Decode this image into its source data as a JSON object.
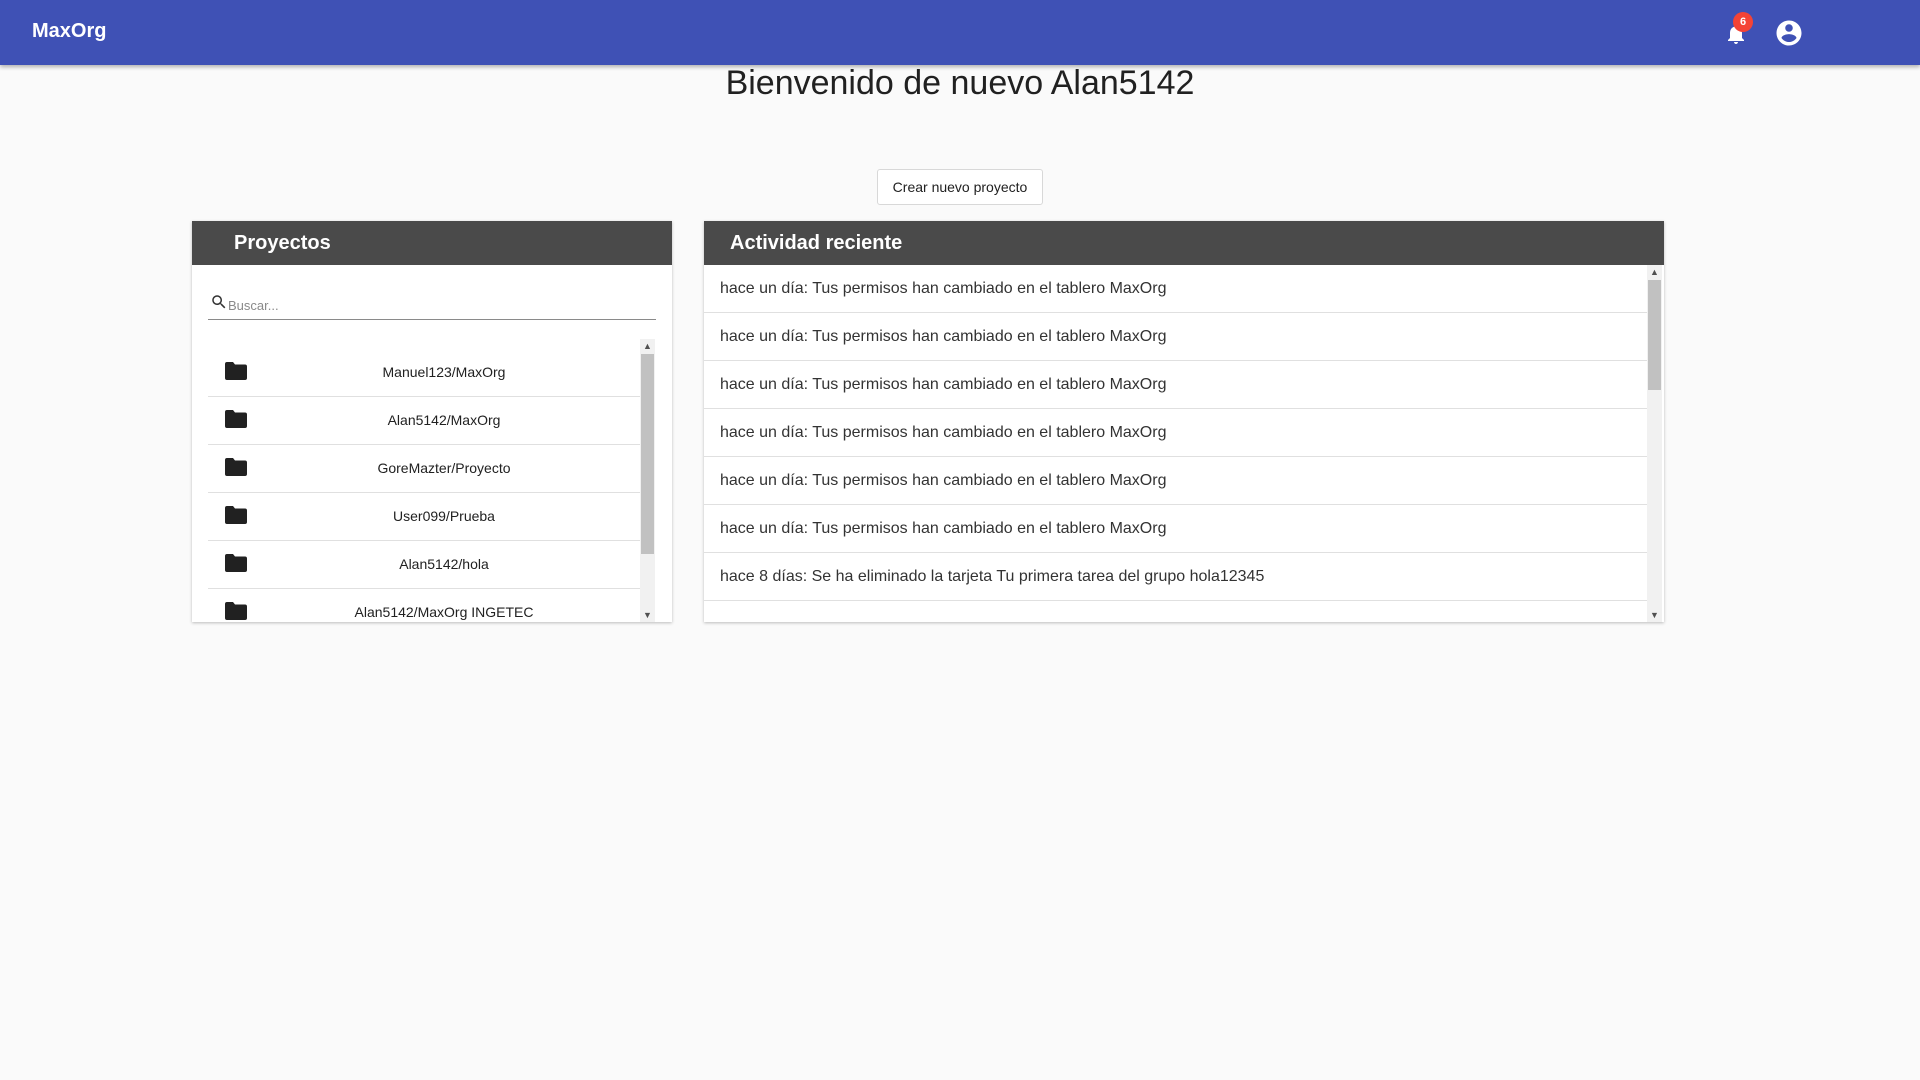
{
  "app": {
    "brand": "MaxOrg"
  },
  "header": {
    "notification_count": "6",
    "notification_icon": "bell-icon",
    "account_icon": "account-circle-icon"
  },
  "welcome": "Bienvenido de nuevo Alan5142",
  "create_button": "Crear nuevo proyecto",
  "projects": {
    "title": "Proyectos",
    "search_placeholder": "Buscar...",
    "items": [
      {
        "label": "Manuel123/MaxOrg"
      },
      {
        "label": "Alan5142/MaxOrg"
      },
      {
        "label": "GoreMazter/Proyecto"
      },
      {
        "label": "User099/Prueba"
      },
      {
        "label": "Alan5142/hola"
      },
      {
        "label": "Alan5142/MaxOrg INGETEC"
      }
    ]
  },
  "activity": {
    "title": "Actividad reciente",
    "items": [
      {
        "text": "hace un día: Tus permisos han cambiado en el tablero MaxOrg"
      },
      {
        "text": "hace un día: Tus permisos han cambiado en el tablero MaxOrg"
      },
      {
        "text": "hace un día: Tus permisos han cambiado en el tablero MaxOrg"
      },
      {
        "text": "hace un día: Tus permisos han cambiado en el tablero MaxOrg"
      },
      {
        "text": "hace un día: Tus permisos han cambiado en el tablero MaxOrg"
      },
      {
        "text": "hace un día: Tus permisos han cambiado en el tablero MaxOrg"
      },
      {
        "text": "hace 8 días: Se ha eliminado la tarjeta Tu primera tarea del grupo hola12345"
      }
    ]
  },
  "colors": {
    "primary": "#3f51b5",
    "panel_header": "#4a4a4a",
    "badge": "#f44336",
    "background": "#fafafa"
  }
}
